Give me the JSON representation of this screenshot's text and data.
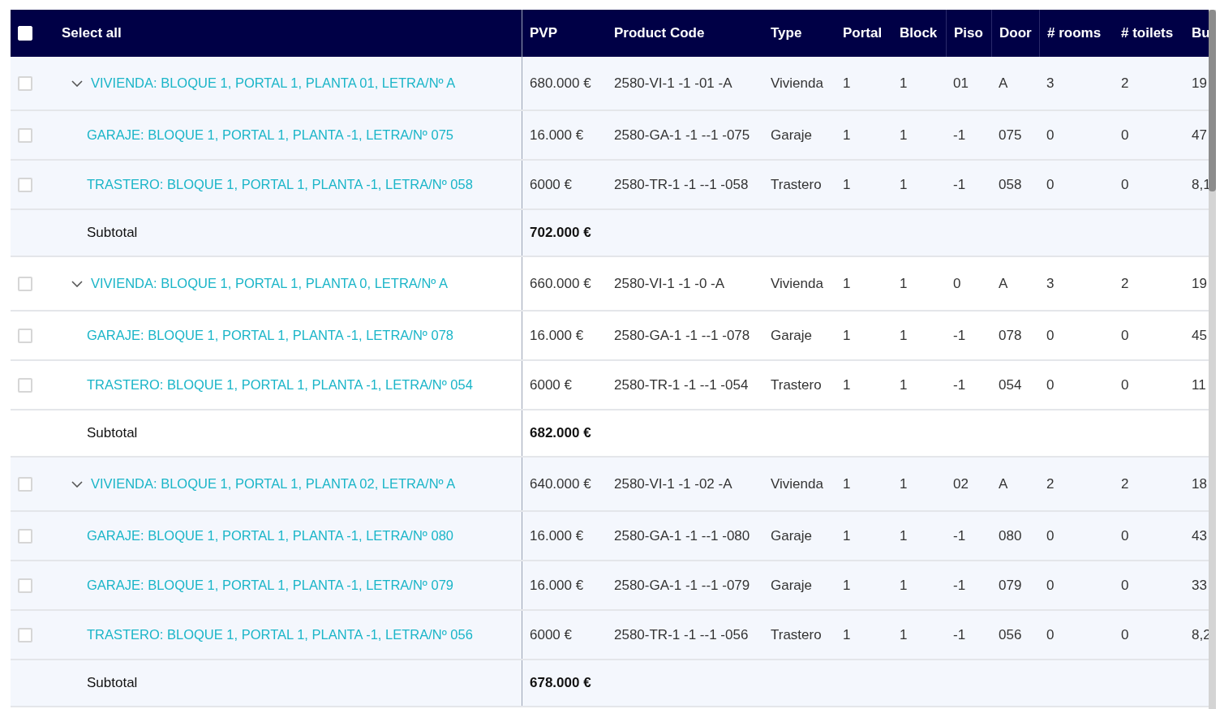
{
  "table": {
    "select_all": {
      "label": "Select all",
      "checked": false
    },
    "columns": [
      "PVP",
      "Product Code",
      "Type",
      "Portal",
      "Block",
      "Piso",
      "Door",
      "# rooms",
      "# toilets",
      "Bu"
    ],
    "groups": [
      {
        "expanded": true,
        "rows": [
          {
            "kind": "main",
            "checked": false,
            "name": "VIVIENDA: BLOQUE 1, PORTAL 1, PLANTA 01, LETRA/Nº A",
            "cells": [
              "680.000 €",
              "2580-VI-1 -1 -01 -A",
              "Vivienda",
              "1",
              "1",
              "01",
              "A",
              "3",
              "2",
              "19"
            ]
          },
          {
            "kind": "sub",
            "checked": false,
            "name": "GARAJE: BLOQUE 1, PORTAL 1, PLANTA -1, LETRA/Nº 075",
            "cells": [
              "16.000 €",
              "2580-GA-1 -1 --1 -075",
              "Garaje",
              "1",
              "1",
              "-1",
              "075",
              "0",
              "0",
              "47"
            ]
          },
          {
            "kind": "sub",
            "checked": false,
            "name": "TRASTERO: BLOQUE 1, PORTAL 1, PLANTA -1, LETRA/Nº 058",
            "cells": [
              "6000 €",
              "2580-TR-1 -1 --1 -058",
              "Trastero",
              "1",
              "1",
              "-1",
              "058",
              "0",
              "0",
              "8,1"
            ]
          }
        ],
        "subtotal_label": "Subtotal",
        "subtotal": "702.000 €"
      },
      {
        "expanded": true,
        "rows": [
          {
            "kind": "main",
            "checked": false,
            "name": "VIVIENDA: BLOQUE 1, PORTAL 1, PLANTA 0, LETRA/Nº A",
            "cells": [
              "660.000 €",
              "2580-VI-1 -1 -0 -A",
              "Vivienda",
              "1",
              "1",
              "0",
              "A",
              "3",
              "2",
              "19"
            ]
          },
          {
            "kind": "sub",
            "checked": false,
            "name": "GARAJE: BLOQUE 1, PORTAL 1, PLANTA -1, LETRA/Nº 078",
            "cells": [
              "16.000 €",
              "2580-GA-1 -1 --1 -078",
              "Garaje",
              "1",
              "1",
              "-1",
              "078",
              "0",
              "0",
              "45"
            ]
          },
          {
            "kind": "sub",
            "checked": false,
            "name": "TRASTERO: BLOQUE 1, PORTAL 1, PLANTA -1, LETRA/Nº 054",
            "cells": [
              "6000 €",
              "2580-TR-1 -1 --1 -054",
              "Trastero",
              "1",
              "1",
              "-1",
              "054",
              "0",
              "0",
              "11"
            ]
          }
        ],
        "subtotal_label": "Subtotal",
        "subtotal": "682.000 €"
      },
      {
        "expanded": true,
        "rows": [
          {
            "kind": "main",
            "checked": false,
            "name": "VIVIENDA: BLOQUE 1, PORTAL 1, PLANTA 02, LETRA/Nº A",
            "cells": [
              "640.000 €",
              "2580-VI-1 -1 -02 -A",
              "Vivienda",
              "1",
              "1",
              "02",
              "A",
              "2",
              "2",
              "18"
            ]
          },
          {
            "kind": "sub",
            "checked": false,
            "name": "GARAJE: BLOQUE 1, PORTAL 1, PLANTA -1, LETRA/Nº 080",
            "cells": [
              "16.000 €",
              "2580-GA-1 -1 --1 -080",
              "Garaje",
              "1",
              "1",
              "-1",
              "080",
              "0",
              "0",
              "43"
            ]
          },
          {
            "kind": "sub",
            "checked": false,
            "name": "GARAJE: BLOQUE 1, PORTAL 1, PLANTA -1, LETRA/Nº 079",
            "cells": [
              "16.000 €",
              "2580-GA-1 -1 --1 -079",
              "Garaje",
              "1",
              "1",
              "-1",
              "079",
              "0",
              "0",
              "33"
            ]
          },
          {
            "kind": "sub",
            "checked": false,
            "name": "TRASTERO: BLOQUE 1, PORTAL 1, PLANTA -1, LETRA/Nº 056",
            "cells": [
              "6000 €",
              "2580-TR-1 -1 --1 -056",
              "Trastero",
              "1",
              "1",
              "-1",
              "056",
              "0",
              "0",
              "8,2"
            ]
          }
        ],
        "subtotal_label": "Subtotal",
        "subtotal": "678.000 €"
      }
    ]
  }
}
